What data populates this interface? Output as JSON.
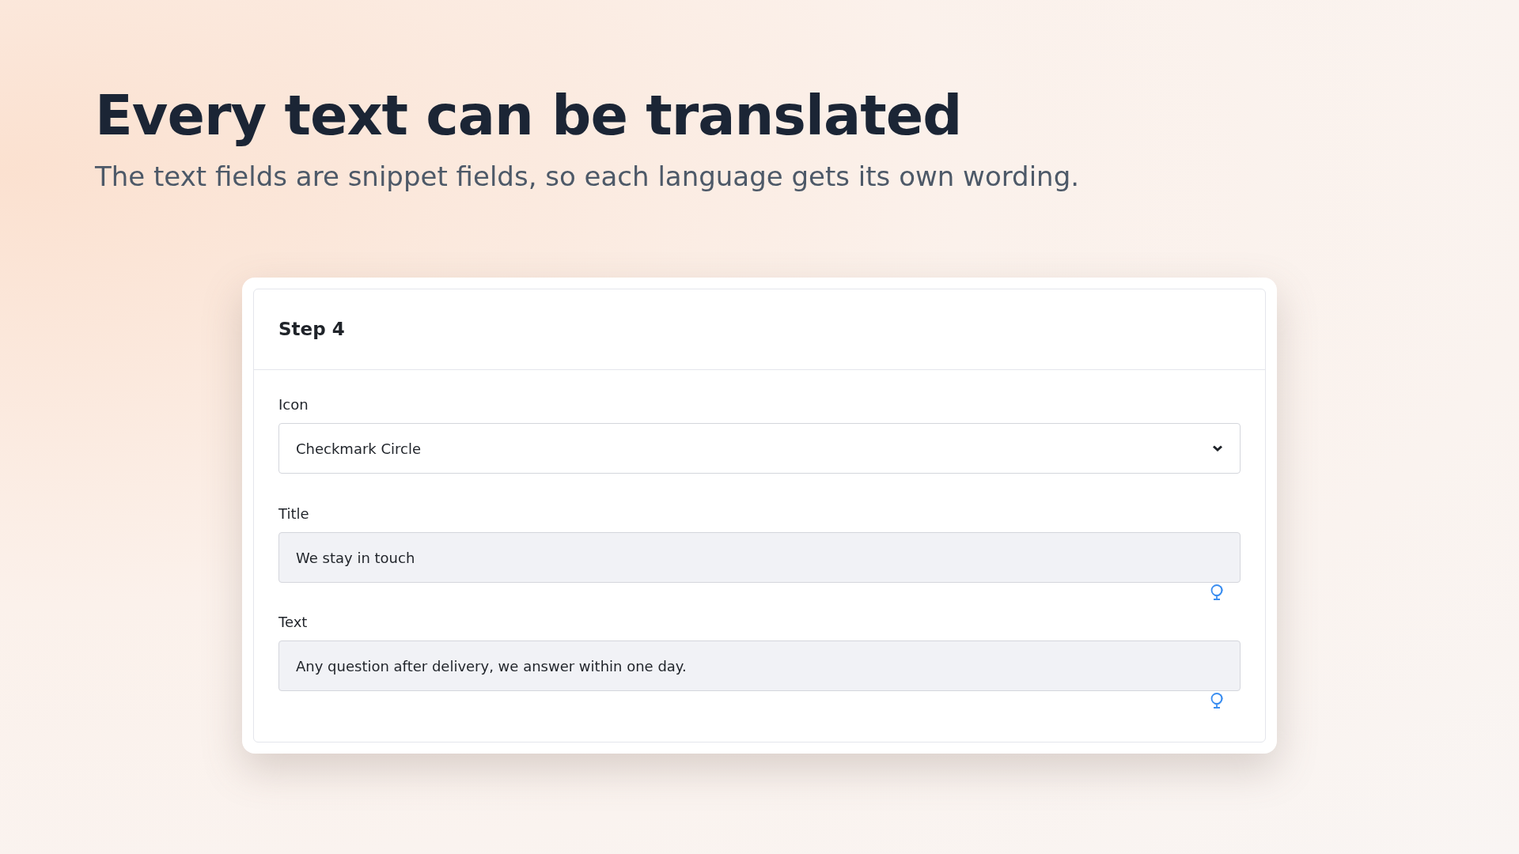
{
  "heading": "Every text can be translated",
  "subtitle": "The text fields are snippet fields, so each language gets its own wording.",
  "panel": {
    "title": "Step 4",
    "fields": [
      {
        "kind": "select",
        "label": "Icon",
        "value": "Checkmark Circle"
      },
      {
        "kind": "text",
        "label": "Title",
        "value": "We stay in touch"
      },
      {
        "kind": "text",
        "label": "Text",
        "value": "Any question after delivery, we answer within one day."
      }
    ]
  }
}
